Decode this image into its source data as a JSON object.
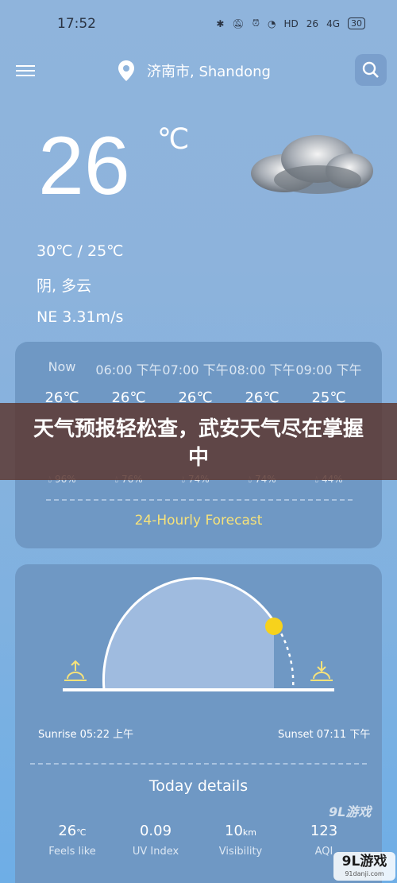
{
  "status": {
    "time": "17:52",
    "icons_text": [
      "HD",
      "26",
      "4G"
    ],
    "battery": "30"
  },
  "header": {
    "location": "济南市, Shandong"
  },
  "current": {
    "temperature": "26",
    "unit": "℃",
    "range": "30℃ / 25℃",
    "condition": "阴, 多云",
    "wind": "NE  3.31m/s"
  },
  "hourly": {
    "hours": [
      "Now",
      "06:00 下午",
      "07:00 下午",
      "08:00 下午",
      "09:00 下午"
    ],
    "temps": [
      "26℃",
      "26℃",
      "26℃",
      "26℃",
      "25℃"
    ],
    "humidity": [
      "96%",
      "76%",
      "74%",
      "74%",
      "44%"
    ],
    "link": "24-Hourly Forecast"
  },
  "banner": {
    "title": "天气预报轻松查，武安天气尽在掌握中"
  },
  "sun": {
    "sunrise": "Sunrise 05:22 上午",
    "sunset": "Sunset 07:11 下午"
  },
  "details": {
    "title": "Today details",
    "items": [
      {
        "value": "26",
        "unit": "℃",
        "label": "Feels like"
      },
      {
        "value": "0.09",
        "unit": "",
        "label": "UV Index"
      },
      {
        "value": "10",
        "unit": "km",
        "label": "Visibility"
      },
      {
        "value": "123",
        "unit": "",
        "label": "AQI"
      }
    ]
  },
  "watermark": {
    "logo": "9L游戏",
    "site": "91danji.com"
  },
  "colors": {
    "accent": "#f6e27a",
    "sun": "#f7d21c",
    "card": "#6f98c4"
  }
}
